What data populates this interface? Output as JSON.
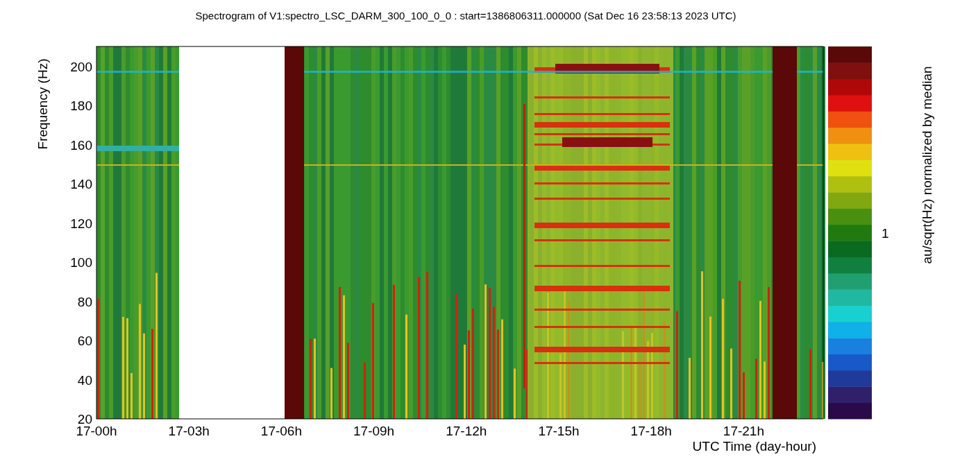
{
  "title": "Spectrogram of V1:spectro_LSC_DARM_300_100_0_0 : start=1386806311.000000 (Sat Dec 16 23:58:13 2023 UTC)",
  "y_axis": {
    "label": "Frequency (Hz)",
    "ticks": [
      "200",
      "180",
      "160",
      "140",
      "120",
      "100",
      "80",
      "60",
      "40",
      "20"
    ]
  },
  "x_axis": {
    "label": "UTC Time (day-hour)",
    "ticks": [
      "17-00h",
      "17-03h",
      "17-06h",
      "17-09h",
      "17-12h",
      "17-15h",
      "17-18h",
      "17-21h"
    ]
  },
  "colorbar": {
    "label": "au/sqrt(Hz) normalized by median",
    "tick": "1"
  }
}
